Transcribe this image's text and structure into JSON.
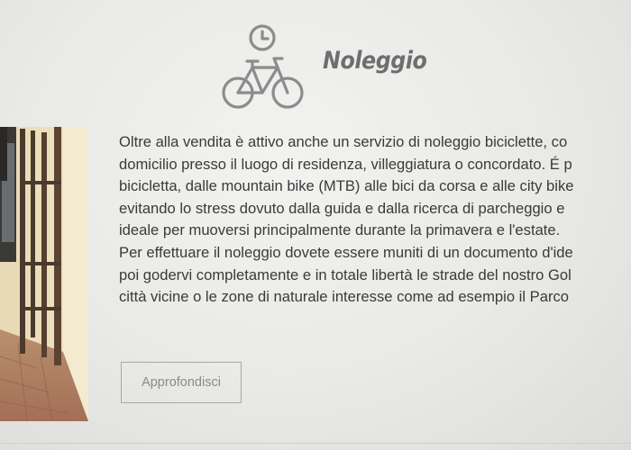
{
  "section": {
    "title": "Noleggio",
    "icon": "bicycle-clock-icon",
    "body_lines": [
      "Oltre alla vendita è attivo anche un servizio di noleggio biciclette, co",
      "domicilio presso il luogo di residenza, villeggiatura o concordato. É p",
      "bicicletta, dalle mountain bike (MTB) alle bici da corsa e alle city bike",
      "evitando lo stress dovuto dalla guida e dalla ricerca di parcheggio e",
      "ideale per muoversi principalmente durante la primavera e l'estate.",
      "Per effettuare il noleggio dovete essere muniti di un documento d'ide",
      "poi godervi completamente e in totale libertà le strade del nostro Gol",
      "città vicine o le zone di naturale interesse come ad esempio il Parco"
    ],
    "button_label": "Approfondisci"
  },
  "colors": {
    "background": "#ececea",
    "icon": "#8c8c8c",
    "title": "#6e6e6e",
    "text": "#3a3a3a",
    "button_border": "#a8a8a8"
  }
}
